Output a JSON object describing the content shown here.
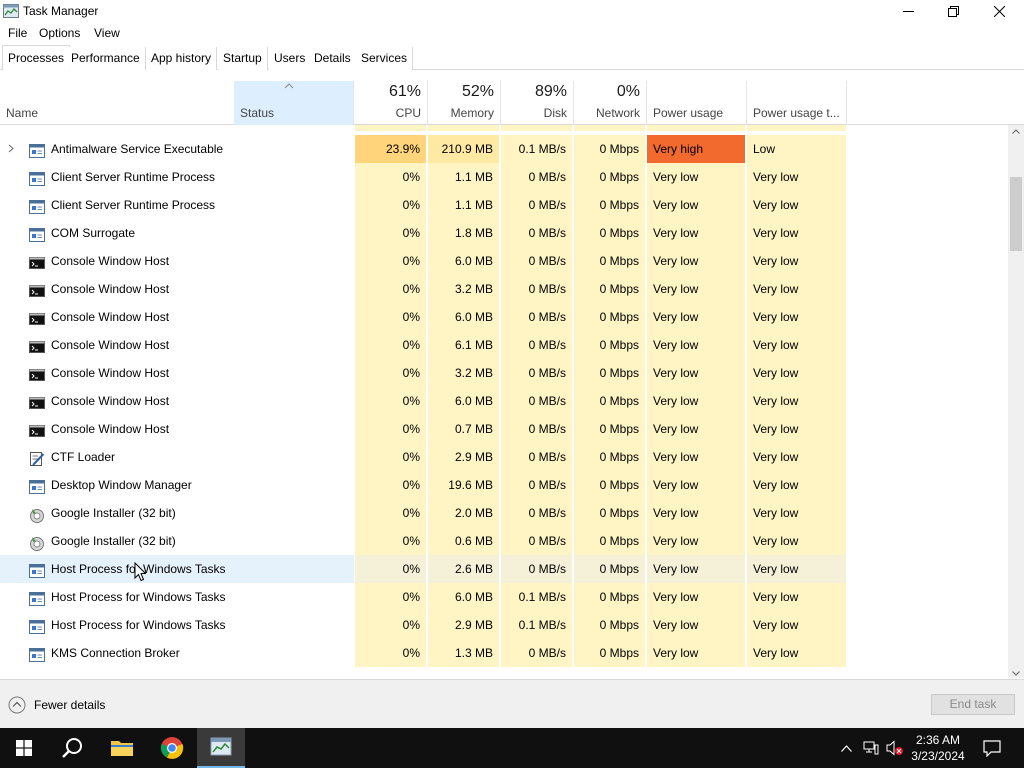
{
  "window": {
    "title": "Task Manager"
  },
  "menu": [
    "File",
    "Options",
    "View"
  ],
  "tabs": [
    "Processes",
    "Performance",
    "App history",
    "Startup",
    "Users",
    "Details",
    "Services"
  ],
  "columns": {
    "name": "Name",
    "status": "Status",
    "cpu": {
      "pct": "61%",
      "label": "CPU"
    },
    "memory": {
      "pct": "52%",
      "label": "Memory"
    },
    "disk": {
      "pct": "89%",
      "label": "Disk"
    },
    "network": {
      "pct": "0%",
      "label": "Network"
    },
    "power": "Power usage",
    "power_trend": "Power usage t..."
  },
  "processes": [
    {
      "name": "Antimalware Service Executable",
      "icon": "service-app-icon",
      "expandable": true,
      "cpu": "23.9%",
      "memory": "210.9 MB",
      "disk": "0.1 MB/s",
      "network": "0 Mbps",
      "power": "Very high",
      "power_trend": "Low"
    },
    {
      "name": "Client Server Runtime Process",
      "icon": "service-app-icon",
      "cpu": "0%",
      "memory": "1.1 MB",
      "disk": "0 MB/s",
      "network": "0 Mbps",
      "power": "Very low",
      "power_trend": "Very low"
    },
    {
      "name": "Client Server Runtime Process",
      "icon": "service-app-icon",
      "cpu": "0%",
      "memory": "1.1 MB",
      "disk": "0 MB/s",
      "network": "0 Mbps",
      "power": "Very low",
      "power_trend": "Very low"
    },
    {
      "name": "COM Surrogate",
      "icon": "service-app-icon",
      "cpu": "0%",
      "memory": "1.8 MB",
      "disk": "0 MB/s",
      "network": "0 Mbps",
      "power": "Very low",
      "power_trend": "Very low"
    },
    {
      "name": "Console Window Host",
      "icon": "console-icon",
      "cpu": "0%",
      "memory": "6.0 MB",
      "disk": "0 MB/s",
      "network": "0 Mbps",
      "power": "Very low",
      "power_trend": "Very low"
    },
    {
      "name": "Console Window Host",
      "icon": "console-icon",
      "cpu": "0%",
      "memory": "3.2 MB",
      "disk": "0 MB/s",
      "network": "0 Mbps",
      "power": "Very low",
      "power_trend": "Very low"
    },
    {
      "name": "Console Window Host",
      "icon": "console-icon",
      "cpu": "0%",
      "memory": "6.0 MB",
      "disk": "0 MB/s",
      "network": "0 Mbps",
      "power": "Very low",
      "power_trend": "Very low"
    },
    {
      "name": "Console Window Host",
      "icon": "console-icon",
      "cpu": "0%",
      "memory": "6.1 MB",
      "disk": "0 MB/s",
      "network": "0 Mbps",
      "power": "Very low",
      "power_trend": "Very low"
    },
    {
      "name": "Console Window Host",
      "icon": "console-icon",
      "cpu": "0%",
      "memory": "3.2 MB",
      "disk": "0 MB/s",
      "network": "0 Mbps",
      "power": "Very low",
      "power_trend": "Very low"
    },
    {
      "name": "Console Window Host",
      "icon": "console-icon",
      "cpu": "0%",
      "memory": "6.0 MB",
      "disk": "0 MB/s",
      "network": "0 Mbps",
      "power": "Very low",
      "power_trend": "Very low"
    },
    {
      "name": "Console Window Host",
      "icon": "console-icon",
      "cpu": "0%",
      "memory": "0.7 MB",
      "disk": "0 MB/s",
      "network": "0 Mbps",
      "power": "Very low",
      "power_trend": "Very low"
    },
    {
      "name": "CTF Loader",
      "icon": "ctf-loader-icon",
      "cpu": "0%",
      "memory": "2.9 MB",
      "disk": "0 MB/s",
      "network": "0 Mbps",
      "power": "Very low",
      "power_trend": "Very low"
    },
    {
      "name": "Desktop Window Manager",
      "icon": "service-app-icon",
      "cpu": "0%",
      "memory": "19.6 MB",
      "disk": "0 MB/s",
      "network": "0 Mbps",
      "power": "Very low",
      "power_trend": "Very low"
    },
    {
      "name": "Google Installer (32 bit)",
      "icon": "installer-icon",
      "cpu": "0%",
      "memory": "2.0 MB",
      "disk": "0 MB/s",
      "network": "0 Mbps",
      "power": "Very low",
      "power_trend": "Very low"
    },
    {
      "name": "Google Installer (32 bit)",
      "icon": "installer-icon",
      "cpu": "0%",
      "memory": "0.6 MB",
      "disk": "0 MB/s",
      "network": "0 Mbps",
      "power": "Very low",
      "power_trend": "Very low"
    },
    {
      "name": "Host Process for Windows Tasks",
      "icon": "service-app-icon",
      "hover": true,
      "cpu": "0%",
      "memory": "2.6 MB",
      "disk": "0 MB/s",
      "network": "0 Mbps",
      "power": "Very low",
      "power_trend": "Very low"
    },
    {
      "name": "Host Process for Windows Tasks",
      "icon": "service-app-icon",
      "cpu": "0%",
      "memory": "6.0 MB",
      "disk": "0.1 MB/s",
      "network": "0 Mbps",
      "power": "Very low",
      "power_trend": "Very low"
    },
    {
      "name": "Host Process for Windows Tasks",
      "icon": "service-app-icon",
      "cpu": "0%",
      "memory": "2.9 MB",
      "disk": "0.1 MB/s",
      "network": "0 Mbps",
      "power": "Very low",
      "power_trend": "Very low"
    },
    {
      "name": "KMS Connection Broker",
      "icon": "service-app-icon",
      "cpu": "0%",
      "memory": "1.3 MB",
      "disk": "0 MB/s",
      "network": "0 Mbps",
      "power": "Very low",
      "power_trend": "Very low"
    }
  ],
  "footer": {
    "fewer_details": "Fewer details",
    "end_task": "End task"
  },
  "taskbar": {
    "time": "2:36 AM",
    "date": "3/23/2024"
  },
  "colors": {
    "very_high": "#f26a2e",
    "cpu_hot": "#ffd47a",
    "cell_bg": "#fff4c4",
    "taskbar": "#101010"
  }
}
